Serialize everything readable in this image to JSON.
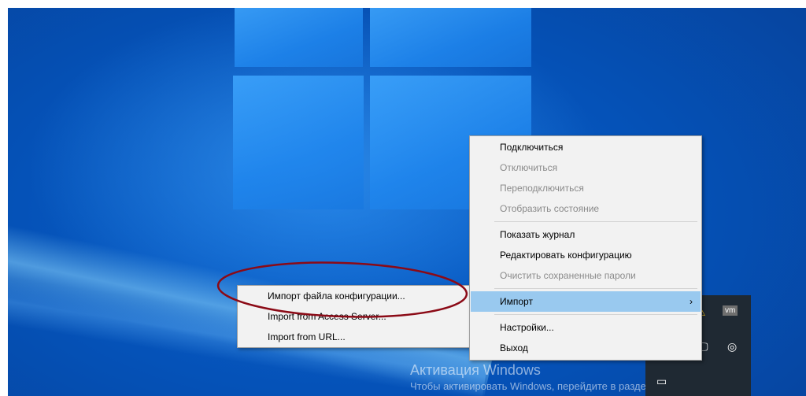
{
  "context_menu": {
    "items": [
      {
        "label": "Подключиться",
        "disabled": false
      },
      {
        "label": "Отключиться",
        "disabled": true
      },
      {
        "label": "Переподключиться",
        "disabled": true
      },
      {
        "label": "Отобразить состояние",
        "disabled": true
      },
      {
        "label": "Показать журнал",
        "disabled": false
      },
      {
        "label": "Редактировать конфигурацию",
        "disabled": false
      },
      {
        "label": "Очистить сохраненные пароли",
        "disabled": true
      },
      {
        "label": "Импорт",
        "disabled": false,
        "highlighted": true,
        "submenu_arrow": "›"
      },
      {
        "label": "Настройки...",
        "disabled": false
      },
      {
        "label": "Выход",
        "disabled": false
      }
    ]
  },
  "import_submenu": {
    "items": [
      {
        "label": "Импорт файла конфигурации..."
      },
      {
        "label": "Import from Access Server..."
      },
      {
        "label": "Import from URL..."
      }
    ]
  },
  "watermark": {
    "title": "Активация Windows",
    "subtitle": "Чтобы активировать Windows, перейдите в раздел \"Параметры\"."
  },
  "tray": {
    "vm_label": "vm",
    "icons": [
      "warning-icon",
      "vmware-icon",
      "network-icon",
      "monitor-icon",
      "camera-icon",
      "display-icon"
    ]
  },
  "colors": {
    "menu_bg": "#f2f2f2",
    "highlight": "#99c9ef",
    "ellipse": "#8b0a16",
    "desktop_blue": "#0552b8"
  }
}
